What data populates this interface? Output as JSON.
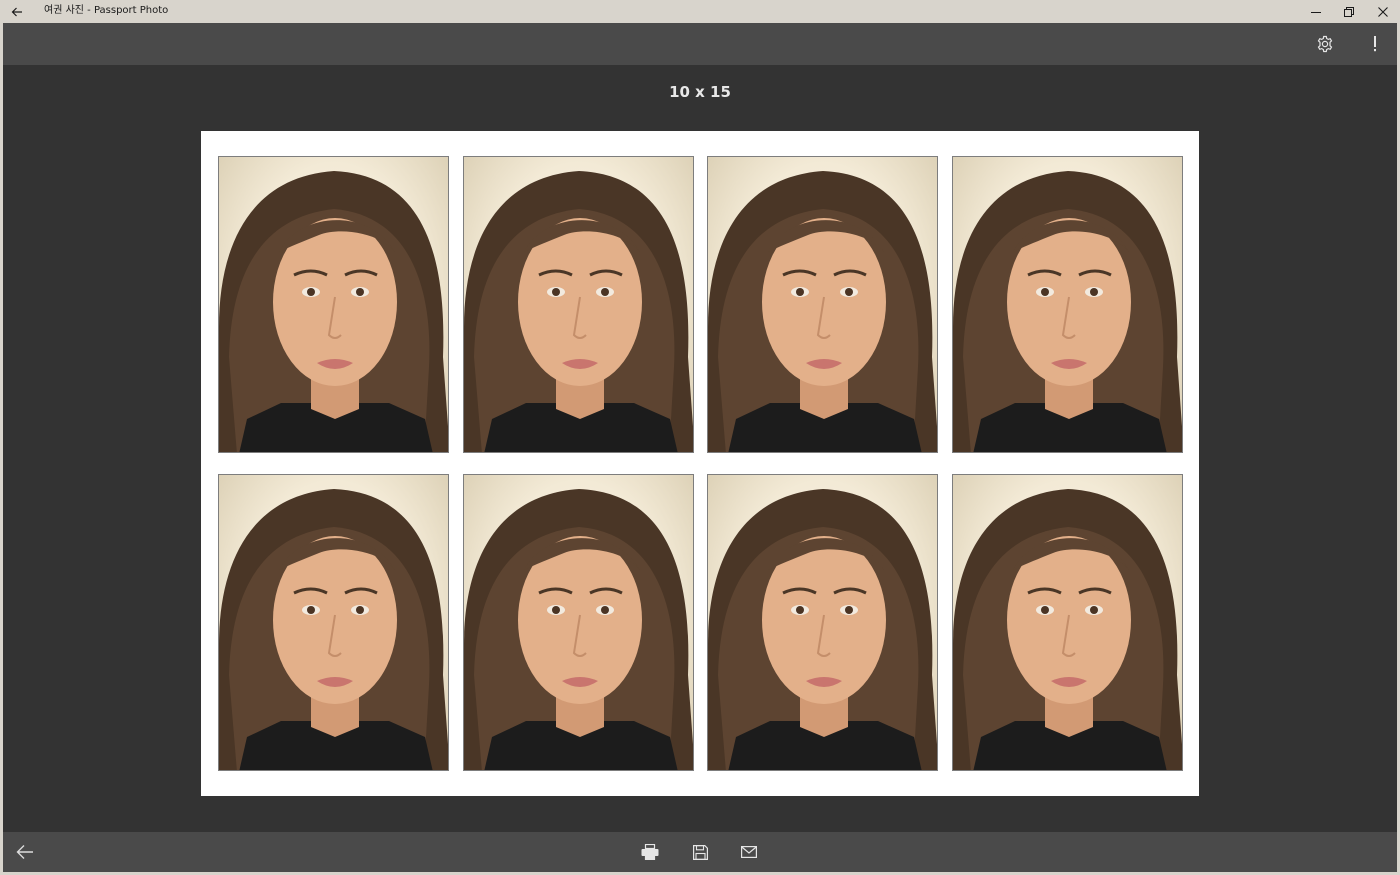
{
  "window": {
    "title": "여권 사진 - Passport Photo",
    "icons": {
      "back": "back-arrow-icon",
      "minimize": "minimize-icon",
      "restore": "restore-icon",
      "close": "close-icon"
    }
  },
  "command_bar": {
    "icons": [
      "gear-icon",
      "exclamation-icon"
    ]
  },
  "sheet": {
    "size_label": "10 x 15",
    "photo_count": 8,
    "layout": "2 rows x 4 columns"
  },
  "bottom_bar": {
    "icons": [
      "back-arrow-icon",
      "printer-icon",
      "save-icon",
      "mail-icon"
    ]
  },
  "colors": {
    "titlebar": "#d8d4cc",
    "command_bar": "#4a4a4a",
    "canvas": "#333333",
    "sheet": "#ffffff"
  }
}
